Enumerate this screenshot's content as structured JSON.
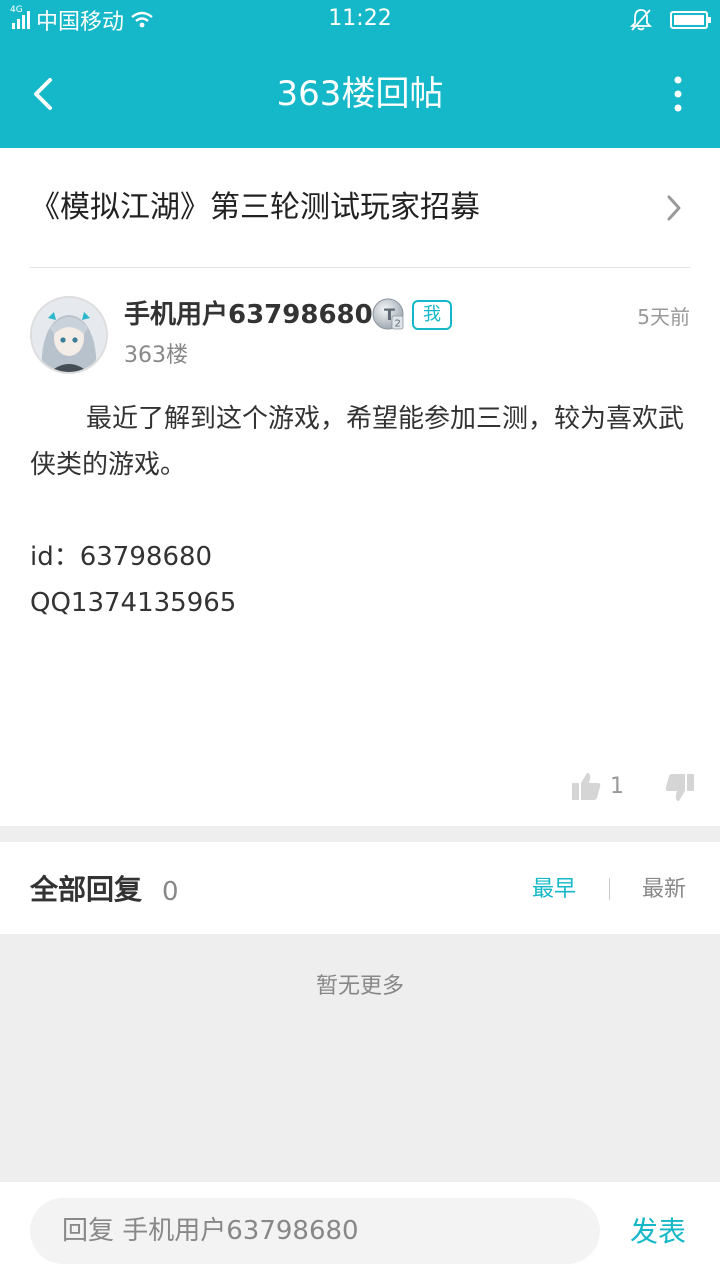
{
  "status_bar": {
    "network": "4G",
    "carrier": "中国移动",
    "time": "11:22",
    "battery_level": 1.0
  },
  "nav": {
    "title": "363楼回帖",
    "back_icon": "chevron-left-icon",
    "more_icon": "more-vertical-icon"
  },
  "thread": {
    "title": "《模拟江湖》第三轮测试玩家招募"
  },
  "post": {
    "username": "手机用户63798680",
    "level_badge": "T2",
    "me_badge": "我",
    "floor": "363楼",
    "time_ago": "5天前",
    "body_lines": [
      "最近了解到这个游戏，希望能参加三测，较为喜欢武侠类的游戏。",
      "",
      "id：63798680",
      "QQ1374135965"
    ],
    "like_count": "1"
  },
  "replies": {
    "title": "全部回复",
    "count": "0",
    "sort_earliest": "最早",
    "sort_latest": "最新",
    "empty_text": "暂无更多"
  },
  "reply_bar": {
    "placeholder": "回复 手机用户63798680",
    "send_label": "发表"
  },
  "colors": {
    "accent": "#14b8c8",
    "background_gray": "#eeeeee"
  }
}
